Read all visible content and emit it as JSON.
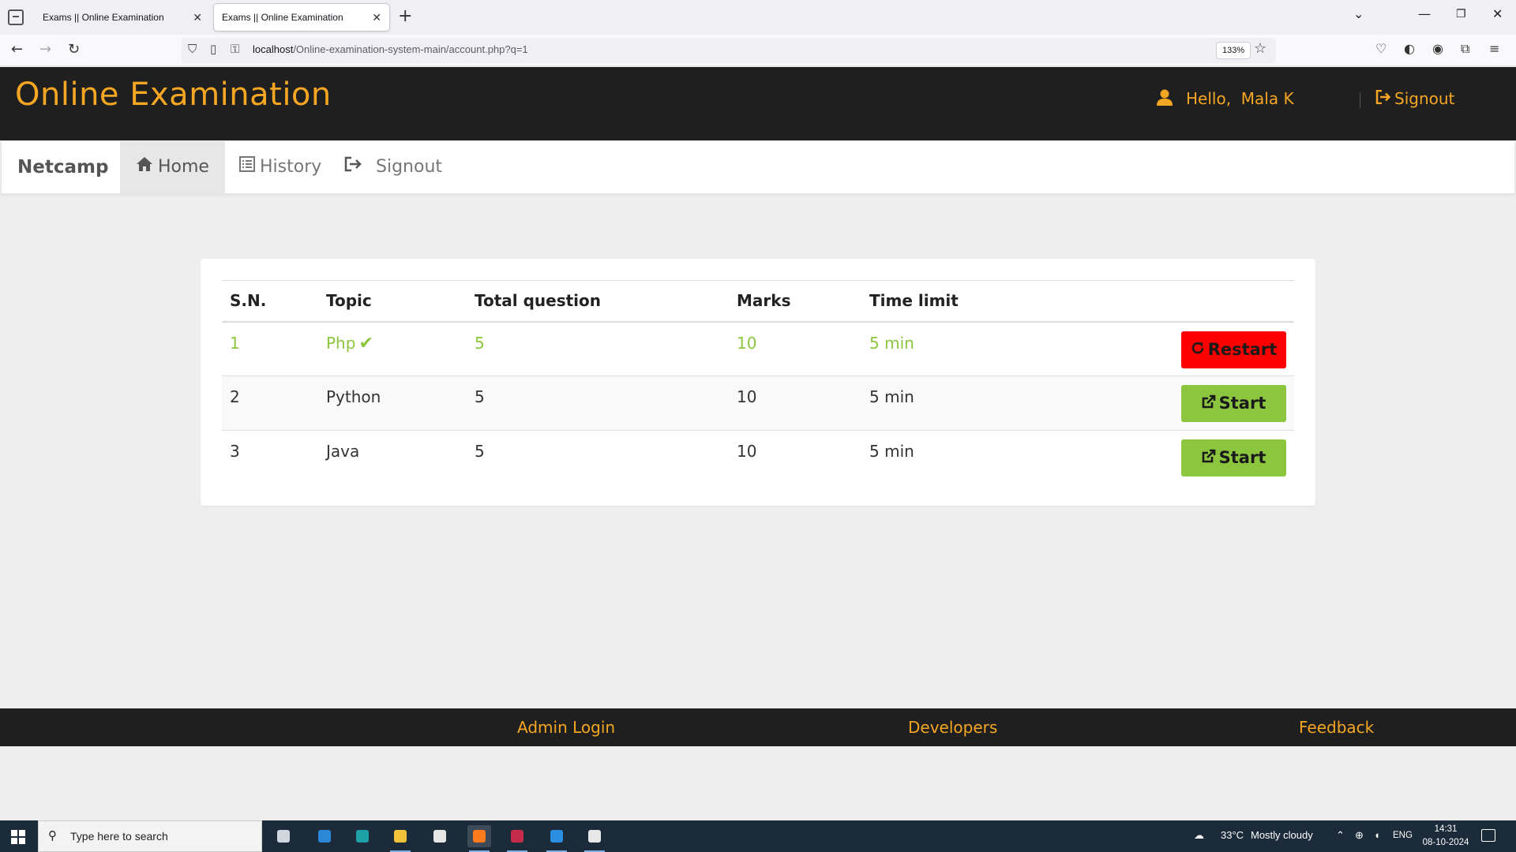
{
  "browser": {
    "tabs": [
      {
        "title": "Exams || Online Examination",
        "close": "✕"
      },
      {
        "title": "Exams || Online Examination",
        "close": "✕"
      }
    ],
    "new_tab": "+",
    "url_host": "localhost",
    "url_path": "/Online-examination-system-main/account.php?q=1",
    "zoom": "133%"
  },
  "header": {
    "title": "Online Examination",
    "greeting": "Hello,",
    "user_name": "Mala K",
    "signout_label": "Signout"
  },
  "menu": {
    "brand": "Netcamp",
    "items": [
      {
        "label": "Home",
        "icon": "home-icon",
        "active": true
      },
      {
        "label": "History",
        "icon": "list-icon",
        "active": false
      },
      {
        "label": "Signout",
        "icon": "signout-icon",
        "active": false
      }
    ]
  },
  "quiz_table": {
    "headers": [
      "S.N.",
      "Topic",
      "Total question",
      "Marks",
      "Time limit"
    ],
    "rows": [
      {
        "sn": "1",
        "topic": "Php",
        "total": "5",
        "marks": "10",
        "time": "5 min",
        "action": "Restart",
        "completed": true
      },
      {
        "sn": "2",
        "topic": "Python",
        "total": "5",
        "marks": "10",
        "time": "5 min",
        "action": "Start",
        "completed": false
      },
      {
        "sn": "3",
        "topic": "Java",
        "total": "5",
        "marks": "10",
        "time": "5 min",
        "action": "Start",
        "completed": false
      }
    ]
  },
  "footer": {
    "admin_login": "Admin Login",
    "developers": "Developers",
    "feedback": "Feedback"
  },
  "taskbar": {
    "search_placeholder": "Type here to search",
    "weather_temp": "33°C",
    "weather_desc": "Mostly cloudy",
    "language": "ENG",
    "time": "14:31",
    "date": "08-10-2024"
  },
  "colors": {
    "accent_orange": "#f5a623",
    "header_bg": "#1f1f1f",
    "completed_green": "#8cc63f",
    "restart_red": "#ff0000"
  }
}
